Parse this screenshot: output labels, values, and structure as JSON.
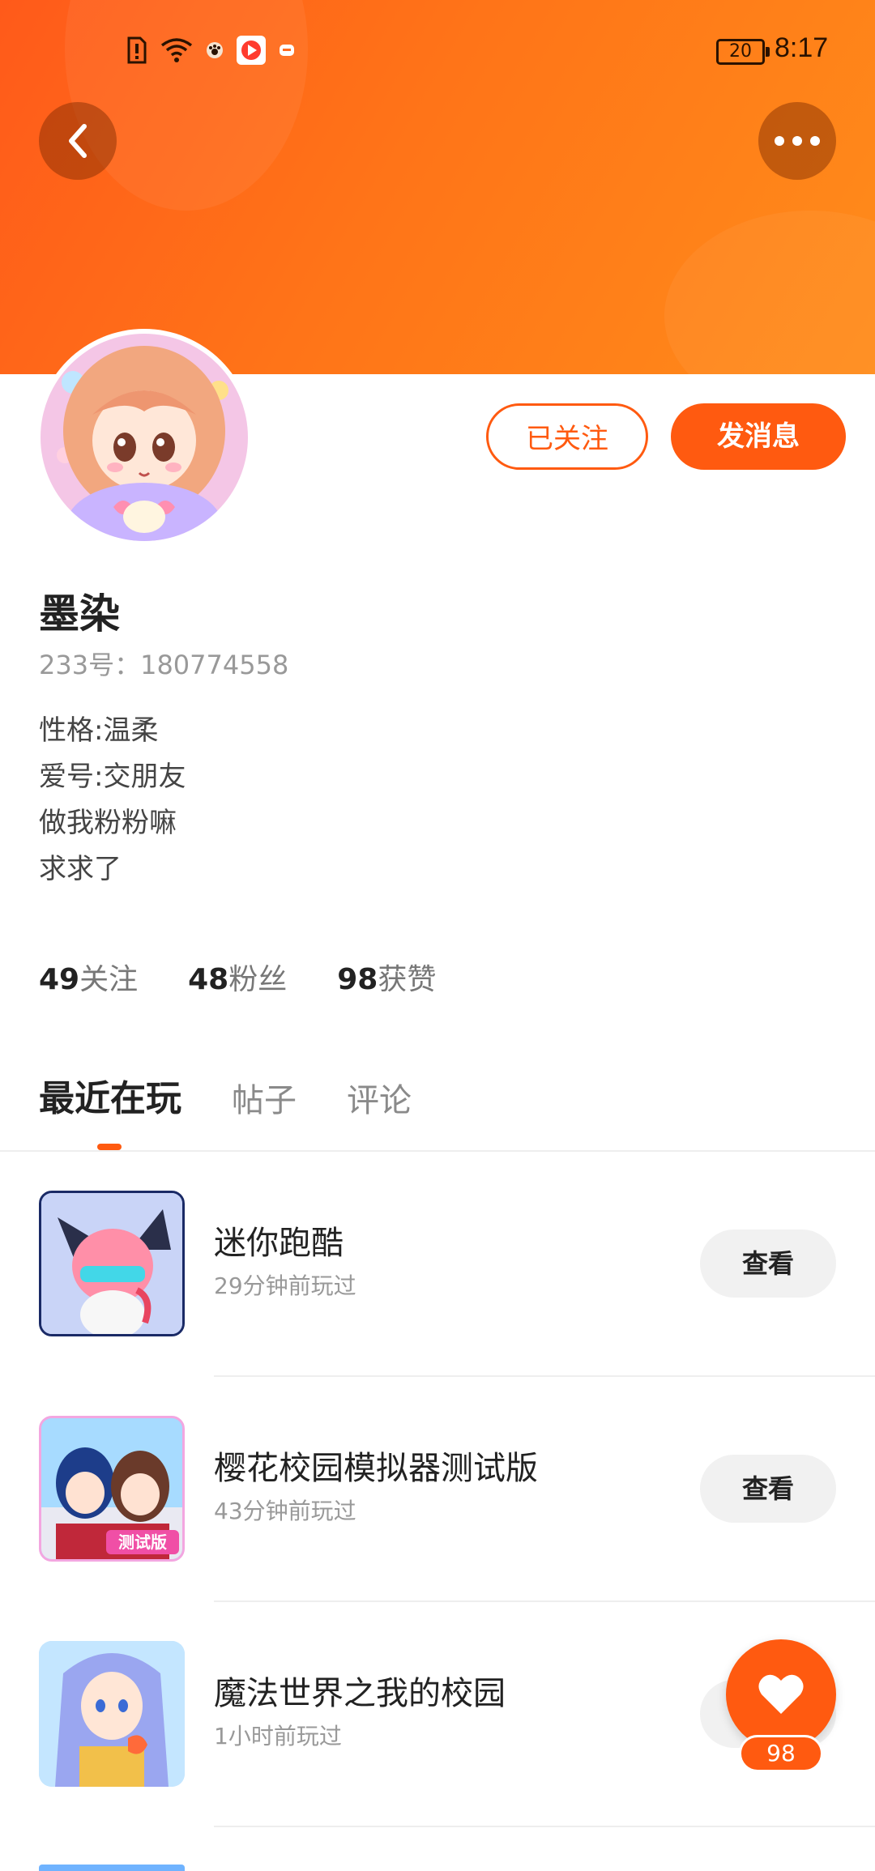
{
  "status_bar": {
    "battery": "20",
    "time": "8:17"
  },
  "profile": {
    "name": "墨染",
    "uid": "233号：180774558",
    "bio": [
      "性格:温柔",
      "爱号:交朋友",
      "做我粉粉嘛",
      "求求了"
    ],
    "followed_label": "已关注",
    "message_label": "发消息"
  },
  "stats": [
    {
      "num": "49",
      "label": "关注"
    },
    {
      "num": "48",
      "label": "粉丝"
    },
    {
      "num": "98",
      "label": "获赞"
    }
  ],
  "tabs": [
    {
      "label": "最近在玩",
      "active": true
    },
    {
      "label": "帖子",
      "active": false
    },
    {
      "label": "评论",
      "active": false
    }
  ],
  "games": [
    {
      "title": "迷你跑酷",
      "time": "29分钟前玩过",
      "button": "查看",
      "icon": "mini-parkour-game-icon"
    },
    {
      "title": "樱花校园模拟器测试版",
      "time": "43分钟前玩过",
      "button": "查看",
      "icon": "sakura-school-game-icon"
    },
    {
      "title": "魔法世界之我的校园",
      "time": "1小时前玩过",
      "button": "查看",
      "icon": "magic-world-game-icon"
    }
  ],
  "fab": {
    "count": "98"
  },
  "colors": {
    "accent": "#ff5a10",
    "header": "#ff7418"
  }
}
